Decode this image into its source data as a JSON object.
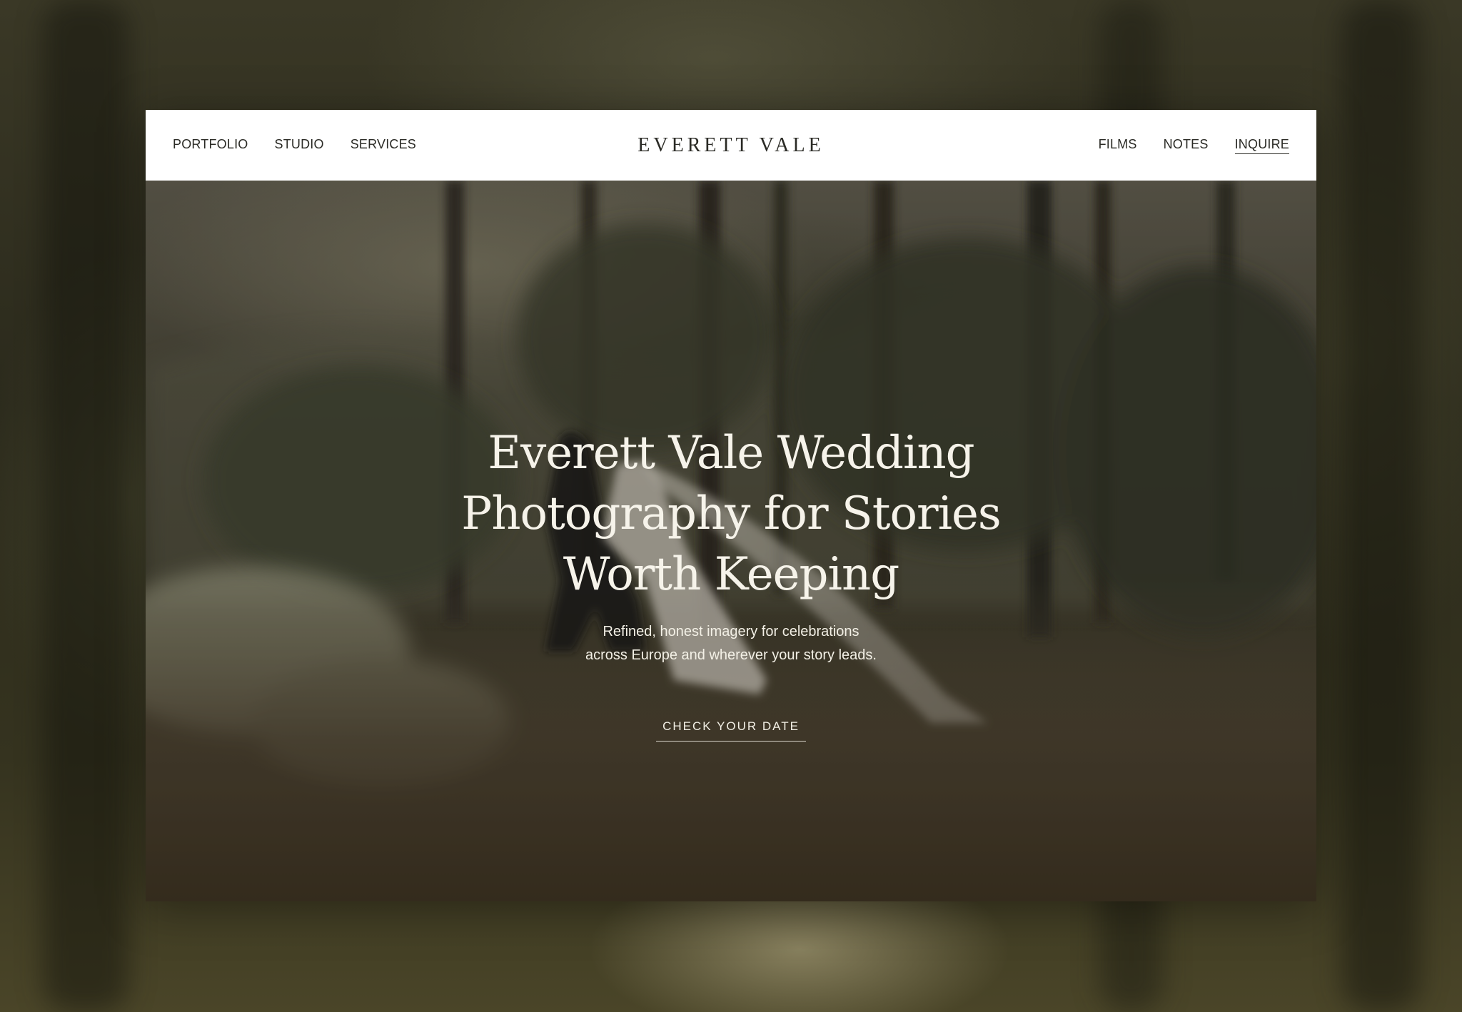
{
  "brand": {
    "logo_text": "EVERETT VALE"
  },
  "nav": {
    "left": [
      {
        "label": "PORTFOLIO"
      },
      {
        "label": "STUDIO"
      },
      {
        "label": "SERVICES"
      }
    ],
    "right": [
      {
        "label": "FILMS"
      },
      {
        "label": "NOTES"
      },
      {
        "label": "INQUIRE",
        "active": true
      }
    ]
  },
  "hero": {
    "title_lines": [
      "Everett Vale Wedding",
      "Photography for Stories",
      "Worth Keeping"
    ],
    "subtitle_lines": [
      "Refined, honest imagery for celebrations",
      "across Europe and wherever your story leads."
    ],
    "cta_label": "CHECK YOUR DATE"
  },
  "colors": {
    "page_background": "#2c2a1e",
    "nav_background": "#ffffff",
    "nav_text": "#2a2a25",
    "hero_text": "#f6f3ea"
  }
}
